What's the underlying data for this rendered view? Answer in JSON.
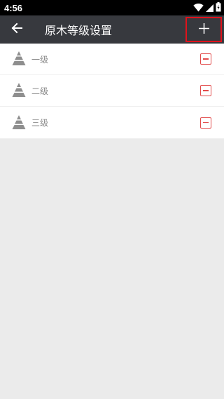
{
  "status_bar": {
    "time": "4:56",
    "icons": [
      "wifi-icon",
      "cell-signal-icon",
      "battery-icon"
    ]
  },
  "app_bar": {
    "title": "原木等级设置",
    "back_icon": "back-arrow-icon",
    "add_icon": "plus-icon"
  },
  "levels": [
    {
      "label": "一级",
      "icon": "tree-icon",
      "action_icon": "remove-icon"
    },
    {
      "label": "二级",
      "icon": "tree-icon",
      "action_icon": "remove-icon"
    },
    {
      "label": "三级",
      "icon": "tree-icon",
      "action_icon": "remove-icon"
    }
  ],
  "colors": {
    "app_bar_bg": "#37393e",
    "highlight_border": "#e0121b",
    "remove_red": "#e24b4b",
    "page_bg": "#ebebeb"
  }
}
